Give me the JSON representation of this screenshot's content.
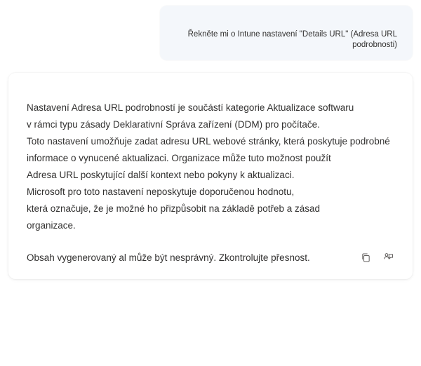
{
  "user_message": {
    "text": "Řekněte mi o Intune nastavení \"Details URL\" (Adresa URL podrobnosti)"
  },
  "assistant_message": {
    "line1": "Nastavení Adresa URL podrobností je součástí kategorie Aktualizace softwaru",
    "line2": "v rámci typu zásady Deklarativní Správa zařízení (DDM) pro počítače.",
    "line3": "Toto nastavení umožňuje zadat adresu URL webové stránky, která poskytuje podrobné",
    "line4": "informace o vynucené aktualizaci. Organizace může tuto možnost použít",
    "line5": "Adresa URL poskytující další kontext nebo pokyny k aktualizaci.",
    "line6": "Microsoft pro toto nastavení neposkytuje doporučenou hodnotu,",
    "line7": "která označuje, že je možné ho přizpůsobit na základě potřeb a zásad",
    "line8": "organizace."
  },
  "footer": {
    "disclaimer": "Obsah vygenerovaný al může být nesprávný. Zkontrolujte přesnost."
  },
  "icons": {
    "copy": "copy-icon",
    "feedback": "feedback-icon"
  }
}
